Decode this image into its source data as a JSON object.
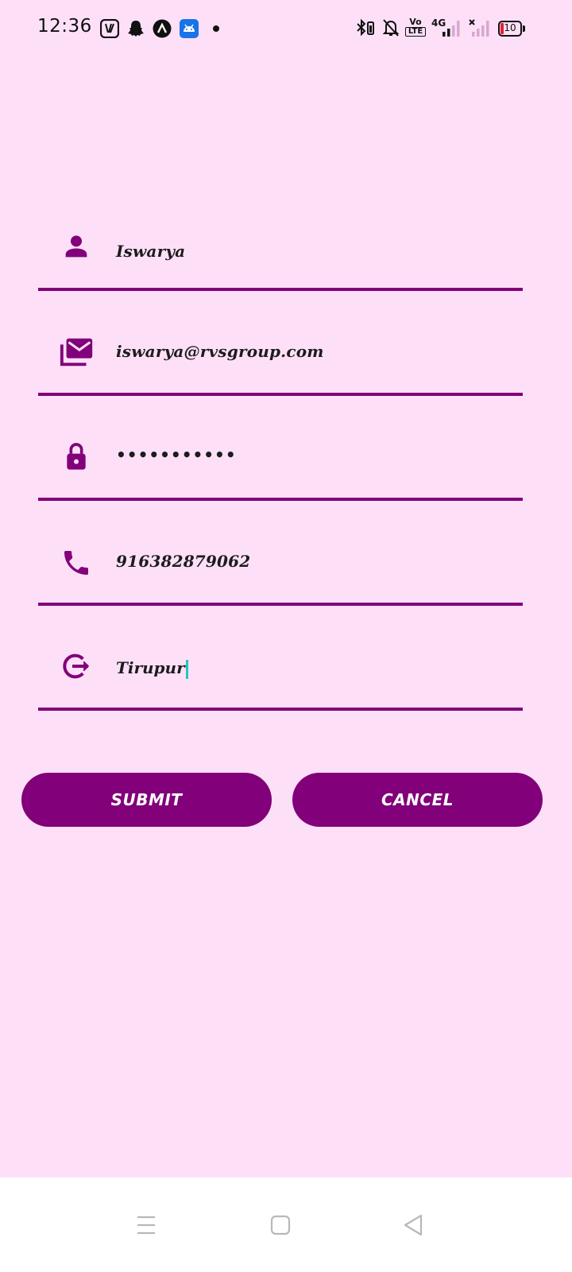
{
  "status_bar": {
    "time": "12:36",
    "notification_icons": [
      "jiosaavn-icon",
      "snapchat-icon",
      "arrow-up-icon",
      "android-icon",
      "dot-icon"
    ],
    "system_icons": [
      "bluetooth-icon",
      "silent-bell-icon",
      "volte-icon",
      "signal-4g-icon",
      "signal-no-service-icon",
      "battery-icon"
    ],
    "volte_label_top": "Vo",
    "volte_label_bottom": "LTE",
    "network_label": "4G",
    "battery_level": "10"
  },
  "form": {
    "fields": [
      {
        "icon": "person-icon",
        "value": "Iswarya"
      },
      {
        "icon": "mail-icon",
        "value": "iswarya@rvsgroup.com"
      },
      {
        "icon": "lock-icon",
        "value": "•••••••••••"
      },
      {
        "icon": "phone-icon",
        "value": "916382879062"
      },
      {
        "icon": "logout-icon",
        "value": "Tirupur"
      }
    ]
  },
  "buttons": {
    "submit_label": "SUBMIT",
    "cancel_label": "CANCEL"
  },
  "nav_bar": {
    "buttons": [
      "menu-icon",
      "home-icon",
      "back-icon"
    ]
  },
  "colors": {
    "background": "#fde0f8",
    "accent": "#820079",
    "caret": "#1fc8b8"
  }
}
